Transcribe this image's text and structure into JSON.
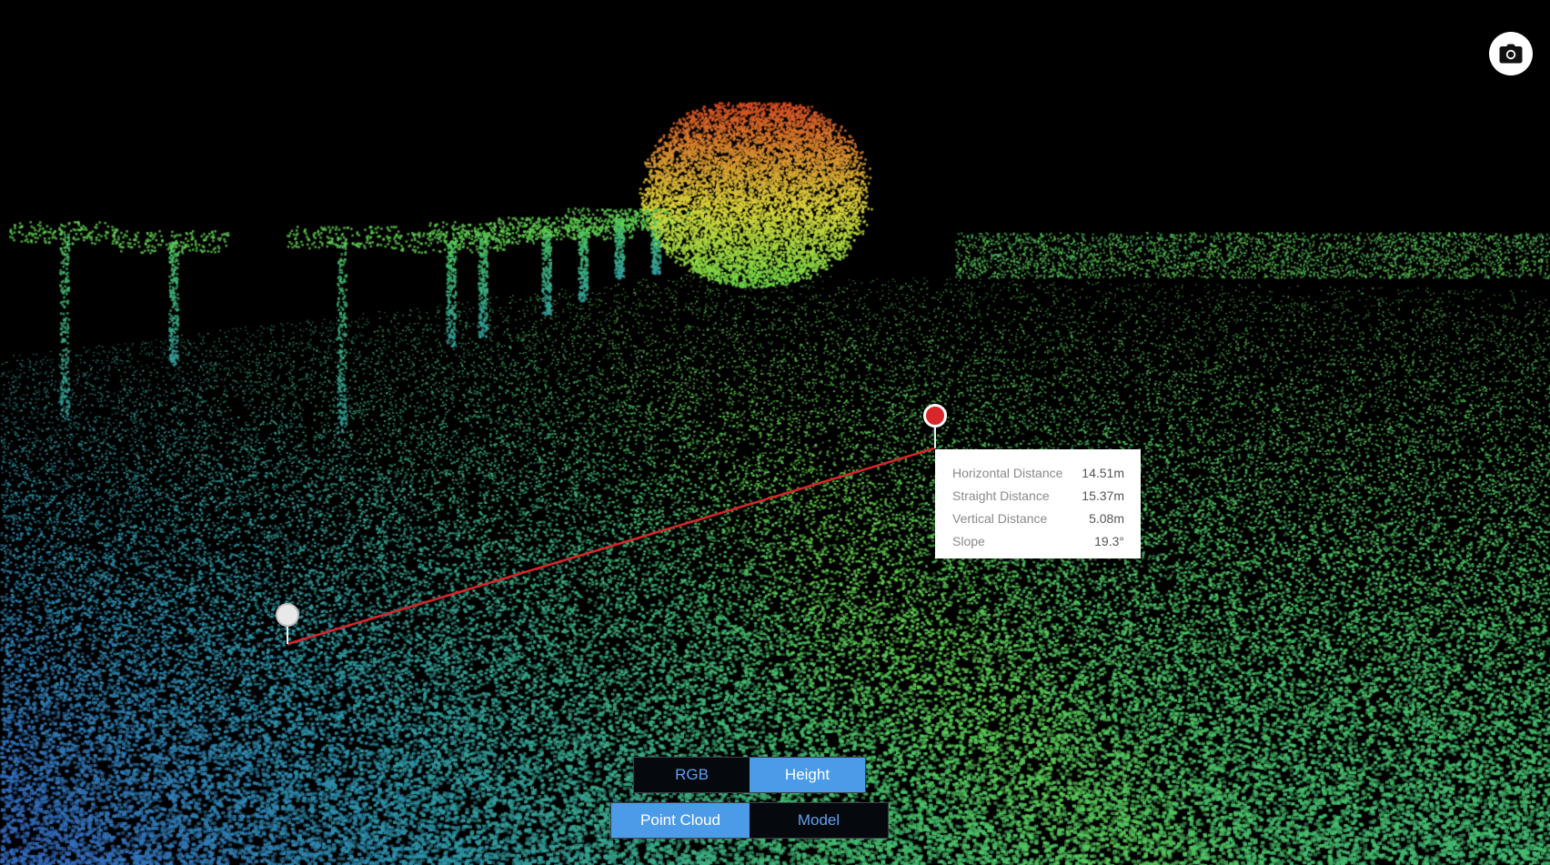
{
  "toolbar": {
    "screenshot_icon": "camera-icon"
  },
  "measurement": {
    "rows": [
      {
        "label": "Horizontal Distance",
        "value": "14.51m"
      },
      {
        "label": "Straight Distance",
        "value": "15.37m"
      },
      {
        "label": "Vertical Distance",
        "value": "5.08m"
      },
      {
        "label": "Slope",
        "value": "19.3°"
      }
    ],
    "line_color": "#d8262b",
    "start_marker_color": "#e8e8e8",
    "end_marker_color": "#d8262b"
  },
  "color_mode": {
    "options": [
      "RGB",
      "Height"
    ],
    "selected": "Height"
  },
  "view_mode": {
    "options": [
      "Point Cloud",
      "Model"
    ],
    "selected": "Point Cloud"
  },
  "theme": {
    "accent": "#4c9be8",
    "accent_text": "#5ea1ef",
    "background": "#000000"
  }
}
